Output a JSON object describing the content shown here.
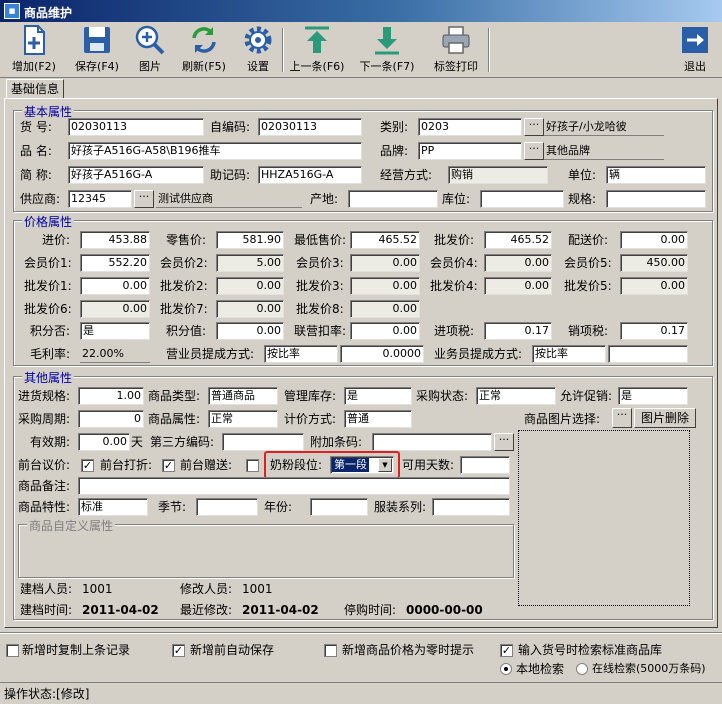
{
  "window": {
    "title": "商品维护"
  },
  "toolbar": [
    "增加(F2)",
    "保存(F4)",
    "图片",
    "刷新(F5)",
    "设置",
    "上一条(F6)",
    "下一条(F7)",
    "标签打印",
    "退出"
  ],
  "tab": "基础信息",
  "basic": {
    "title": "基本属性",
    "huohao_l": "货  号:",
    "huohao": "02030113",
    "zibianma_l": "自编码:",
    "zibianma": "02030113",
    "leibie_l": "类别:",
    "leibie": "0203",
    "leibie_name": "好孩子/小龙哈彼",
    "pinming_l": "品  名:",
    "pinming": "好孩子A516G-A58\\B196推车",
    "pinpai_l": "品牌:",
    "pinpai": "PP",
    "pinpai_name": "其他品牌",
    "jiancheng_l": "简  称:",
    "jiancheng": "好孩子A516G-A",
    "zhuji_l": "助记码:",
    "zhuji": "HHZA516G-A",
    "jingying_l": "经营方式:",
    "jingying": "购销",
    "danwei_l": "单位:",
    "danwei": "辆",
    "gys_l": "供应商:",
    "gys": "12345",
    "gys_name": "测试供应商",
    "chandi_l": "产地:",
    "kuwei_l": "库位:",
    "guige_l": "规格:"
  },
  "price": {
    "title": "价格属性",
    "jinjia_l": "进价:",
    "jinjia": "453.88",
    "lingshou_l": "零售价:",
    "lingshou": "581.90",
    "zuidi_l": "最低售价:",
    "zuidi": "465.52",
    "pifa_l": "批发价:",
    "pifa": "465.52",
    "peisong_l": "配送价:",
    "peisong": "0.00",
    "hy1_l": "会员价1:",
    "hy1": "552.20",
    "hy2_l": "会员价2:",
    "hy2": "5.00",
    "hy3_l": "会员价3:",
    "hy3": "0.00",
    "hy4_l": "会员价4:",
    "hy4": "0.00",
    "hy5_l": "会员价5:",
    "hy5": "450.00",
    "pf1_l": "批发价1:",
    "pf1": "0.00",
    "pf2_l": "批发价2:",
    "pf2": "0.00",
    "pf3_l": "批发价3:",
    "pf3": "0.00",
    "pf4_l": "批发价4:",
    "pf4": "0.00",
    "pf5_l": "批发价5:",
    "pf5": "0.00",
    "pf6_l": "批发价6:",
    "pf6": "0.00",
    "pf7_l": "批发价7:",
    "pf7": "0.00",
    "pf8_l": "批发价8:",
    "pf8": "0.00",
    "jf_l": "积分否:",
    "jf": "是",
    "jfz_l": "积分值:",
    "jfz": "0.00",
    "lykl_l": "联营扣率:",
    "lykl": "0.00",
    "jxs_l": "进项税:",
    "jxs": "0.17",
    "xxs_l": "销项税:",
    "xxs": "0.17",
    "mll_l": "毛利率:",
    "mll": "22.00%",
    "yyy_l": "营业员提成方式:",
    "yyy": "按比率",
    "yyy_v": "0.0000",
    "ywy_l": "业务员提成方式:",
    "ywy": "按比率"
  },
  "other": {
    "title": "其他属性",
    "jhgg_l": "进货规格:",
    "jhgg": "1.00",
    "splx_l": "商品类型:",
    "splx": "普通商品",
    "glkc_l": "管理库存:",
    "glkc": "是",
    "cgzt_l": "采购状态:",
    "cgzt": "正常",
    "yxcx_l": "允许促销:",
    "yxcx": "是",
    "cgzq_l": "采购周期:",
    "cgzq": "0",
    "spsx_l": "商品属性:",
    "spsx": "正常",
    "jjfs_l": "计价方式:",
    "jjfs": "普通",
    "sptp_l": "商品图片选择:",
    "tpsc": "图片删除",
    "yxq_l": "有效期:",
    "yxq": "0.00",
    "tian": "天",
    "dsf_l": "第三方编码:",
    "fjtm_l": "附加条码:",
    "qtyj_l": "前台议价:",
    "qtdz_l": "前台打折:",
    "qtzs_l": "前台赠送:",
    "nfdw_l": "奶粉段位:",
    "nfdw": "第一段",
    "kyts_l": "可用天数:",
    "spbz_l": "商品备注:",
    "sptx_l": "商品特性:",
    "sptx": "标准",
    "jj_l": "季节:",
    "nf_l": "年份:",
    "fzxl_l": "服装系列:",
    "zdy_title": "商品自定义属性",
    "jdry_l": "建档人员:",
    "jdry": "1001",
    "xgry_l": "修改人员:",
    "xgry": "1001",
    "jdsj_l": "建档时间:",
    "jdsj": "2011-04-02",
    "zjxg_l": "最近修改:",
    "zjxg": "2011-04-02",
    "tgsj_l": "停购时间:",
    "tgsj": "0000-00-00"
  },
  "options": {
    "o1": "新增时复制上条记录",
    "o2": "新增前自动保存",
    "o3": "新增商品价格为零时提示",
    "o4": "输入货号时检索标准商品库",
    "r1": "本地检索",
    "r2": "在线检索(5000万条码)"
  },
  "status": {
    "text": "操作状态:[修改]"
  },
  "colors": {
    "title": "#0a246a",
    "group": "#0000a0",
    "highlight": "#e02020",
    "selected": "#0a246a"
  }
}
